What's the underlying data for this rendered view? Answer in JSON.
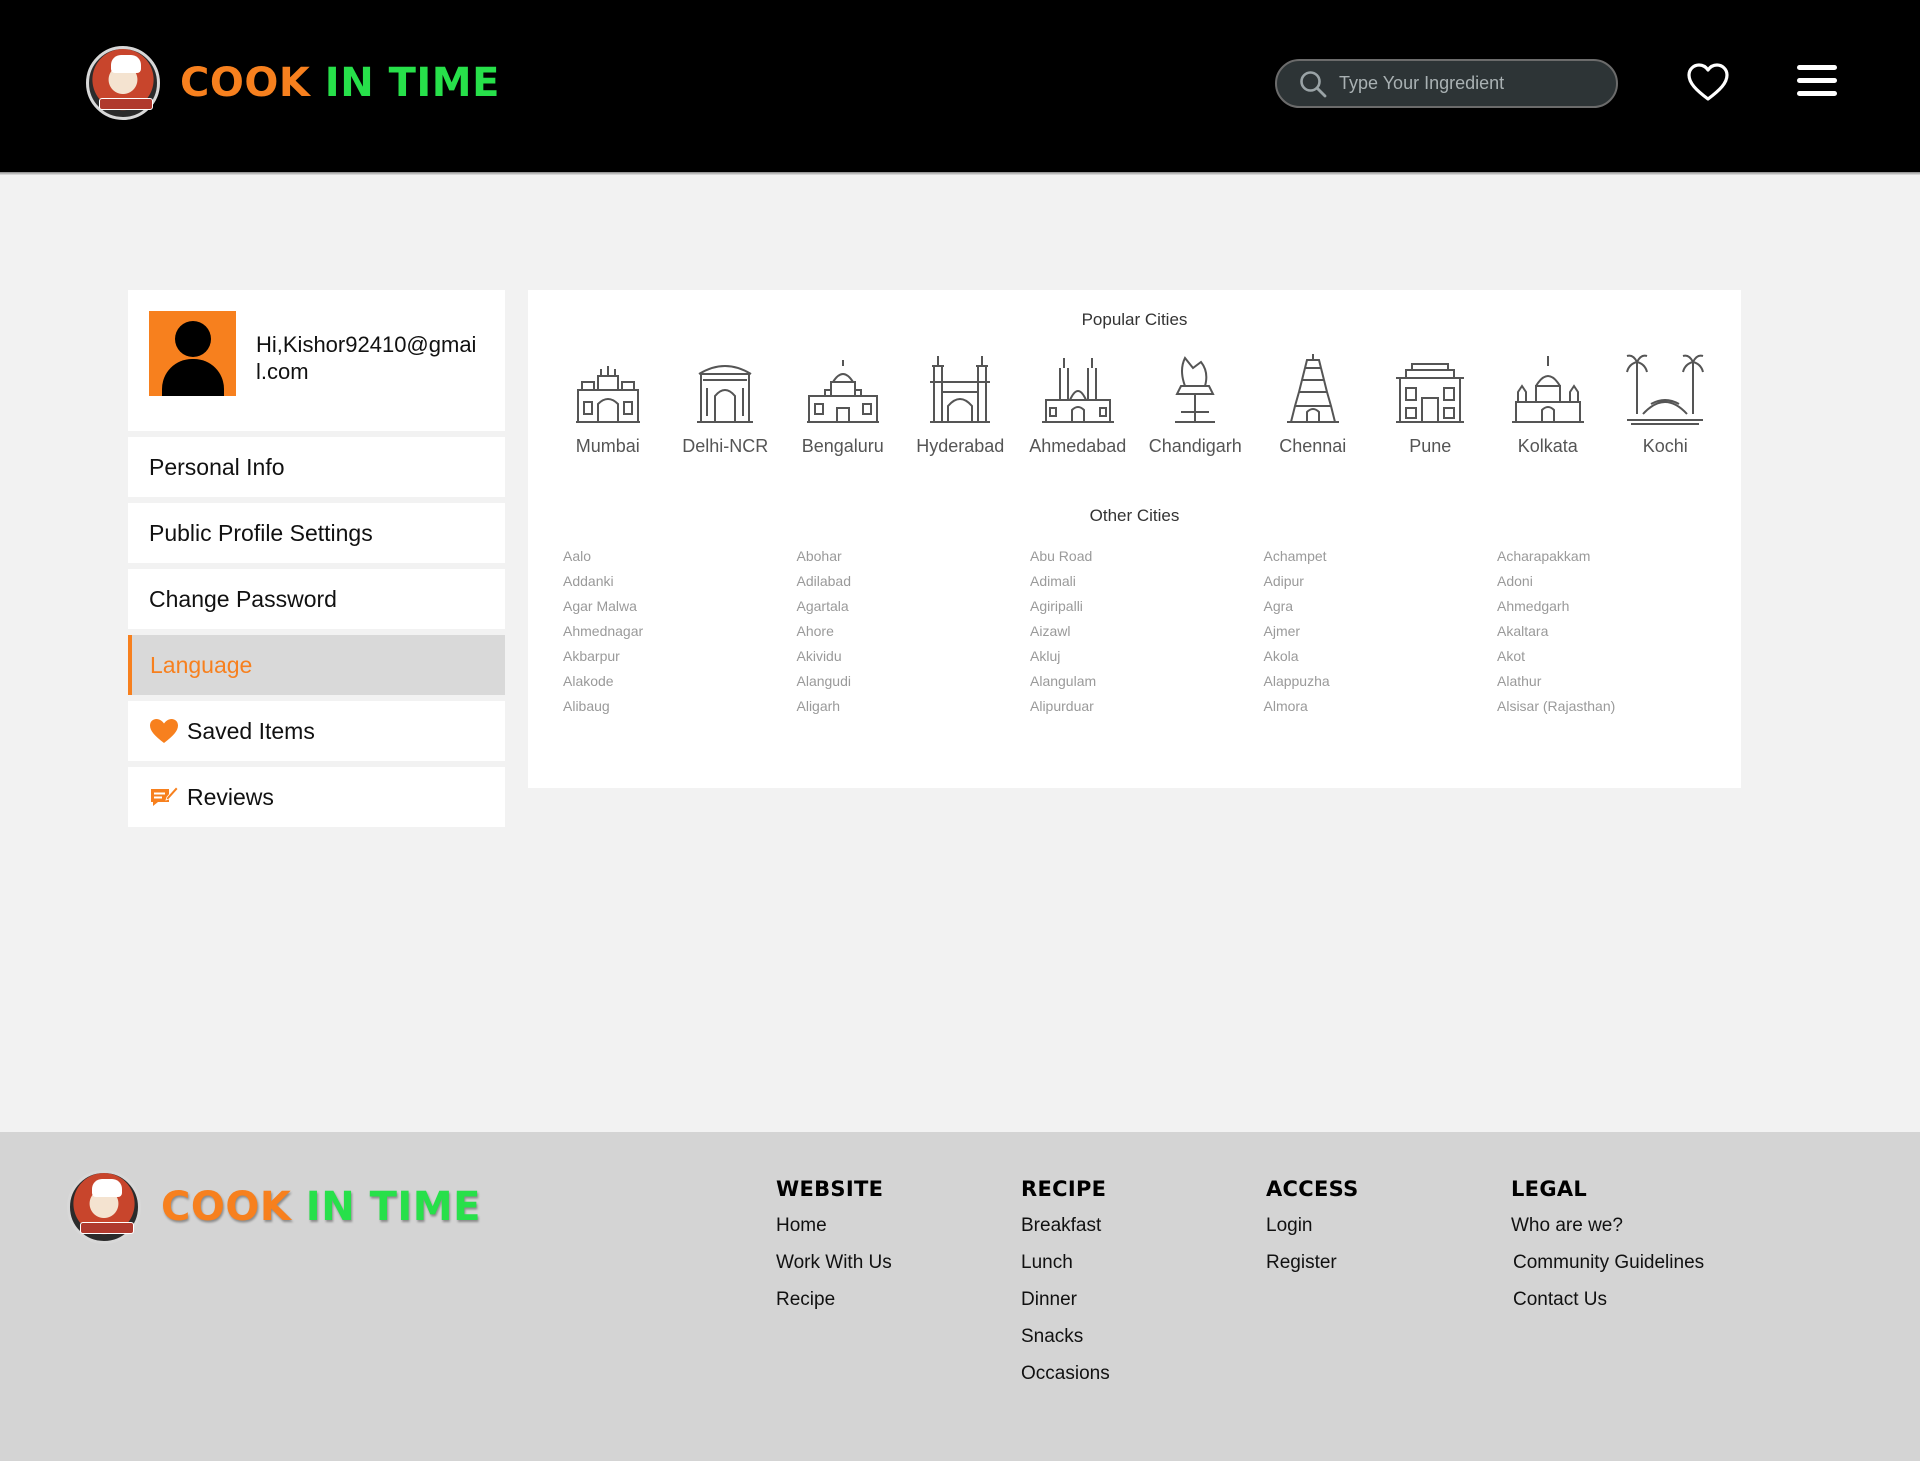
{
  "brand": {
    "part1": "COOK ",
    "part2": "I",
    "part3": "N TIME",
    "badge_text": "COOK IN TIME"
  },
  "search": {
    "placeholder": "Type Your Ingredient"
  },
  "profile": {
    "greeting": "Hi,Kishor92410@gmail.com"
  },
  "sidebar": {
    "items": [
      {
        "label": "Personal Info"
      },
      {
        "label": "Public Profile Settings"
      },
      {
        "label": "Change Password"
      },
      {
        "label": "Language"
      },
      {
        "label": "Saved Items"
      },
      {
        "label": "Reviews"
      }
    ]
  },
  "popular": {
    "title": "Popular Cities",
    "cities": [
      "Mumbai",
      "Delhi-NCR",
      "Bengaluru",
      "Hyderabad",
      "Ahmedabad",
      "Chandigarh",
      "Chennai",
      "Pune",
      "Kolkata",
      "Kochi"
    ]
  },
  "other": {
    "title": "Other Cities",
    "cities": [
      "Aalo",
      "Abohar",
      "Abu Road",
      "Achampet",
      "Acharapakkam",
      "Addanki",
      "Adilabad",
      "Adimali",
      "Adipur",
      "Adoni",
      "Agar Malwa",
      "Agartala",
      "Agiripalli",
      "Agra",
      "Ahmedgarh",
      "Ahmednagar",
      "Ahore",
      "Aizawl",
      "Ajmer",
      "Akaltara",
      "Akbarpur",
      "Akividu",
      "Akluj",
      "Akola",
      "Akot",
      "Alakode",
      "Alangudi",
      "Alangulam",
      "Alappuzha",
      "Alathur",
      "Alibaug",
      "Aligarh",
      "Alipurduar",
      "Almora",
      "Alsisar (Rajasthan)"
    ]
  },
  "footer": {
    "website": {
      "title": "WEBSITE",
      "links": [
        "Home",
        "Work With Us",
        "Recipe"
      ]
    },
    "recipe": {
      "title": "RECIPE",
      "links": [
        "Breakfast",
        "Lunch",
        "Dinner",
        "Snacks",
        "Occasions"
      ]
    },
    "access": {
      "title": "ACCESS",
      "links": [
        "Login",
        "Register"
      ]
    },
    "legal": {
      "title": "LEGAL",
      "links": [
        "Who are we?",
        "Community Guidelines",
        "Contact Us"
      ]
    }
  },
  "colors": {
    "accent": "#f7801e",
    "green": "#27e04a",
    "header": "#000000",
    "footer": "#d4d4d4"
  },
  "icons": [
    "search-icon",
    "heart-icon",
    "menu-icon",
    "user-icon",
    "saved-heart-icon",
    "reviews-icon",
    "chef-logo-icon"
  ]
}
